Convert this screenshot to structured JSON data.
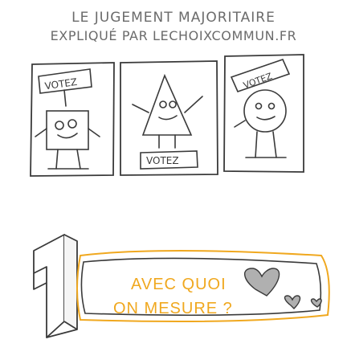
{
  "header": {
    "line1": "LE JUGEMENT MAJORITAIRE",
    "line2": "EXPLIQUÉ PAR LECHOIXCOMMUN.FR"
  },
  "panels": {
    "left_sign": "VOTEZ",
    "middle_sign": "VOTEZ",
    "right_sign": "VOTEZ"
  },
  "step": {
    "number": "1",
    "question_line1": "AVEC QUOI",
    "question_line2": "ON MESURE ?"
  },
  "colors": {
    "accent": "#f0a81f",
    "ink": "#3a3a3a",
    "header_text": "#6b6b6b"
  }
}
